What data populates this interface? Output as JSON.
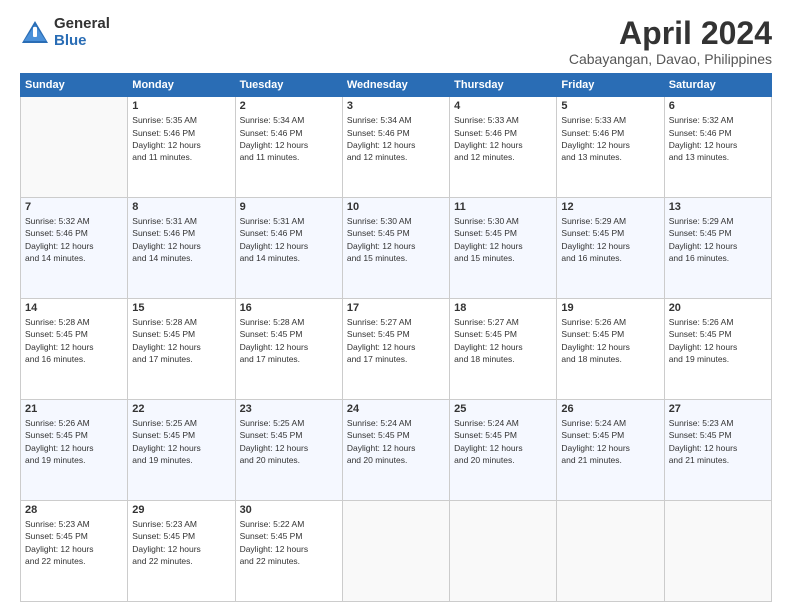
{
  "logo": {
    "general": "General",
    "blue": "Blue"
  },
  "title": "April 2024",
  "location": "Cabayangan, Davao, Philippines",
  "days_header": [
    "Sunday",
    "Monday",
    "Tuesday",
    "Wednesday",
    "Thursday",
    "Friday",
    "Saturday"
  ],
  "weeks": [
    [
      {
        "day": "",
        "info": ""
      },
      {
        "day": "1",
        "info": "Sunrise: 5:35 AM\nSunset: 5:46 PM\nDaylight: 12 hours\nand 11 minutes."
      },
      {
        "day": "2",
        "info": "Sunrise: 5:34 AM\nSunset: 5:46 PM\nDaylight: 12 hours\nand 11 minutes."
      },
      {
        "day": "3",
        "info": "Sunrise: 5:34 AM\nSunset: 5:46 PM\nDaylight: 12 hours\nand 12 minutes."
      },
      {
        "day": "4",
        "info": "Sunrise: 5:33 AM\nSunset: 5:46 PM\nDaylight: 12 hours\nand 12 minutes."
      },
      {
        "day": "5",
        "info": "Sunrise: 5:33 AM\nSunset: 5:46 PM\nDaylight: 12 hours\nand 13 minutes."
      },
      {
        "day": "6",
        "info": "Sunrise: 5:32 AM\nSunset: 5:46 PM\nDaylight: 12 hours\nand 13 minutes."
      }
    ],
    [
      {
        "day": "7",
        "info": "Sunrise: 5:32 AM\nSunset: 5:46 PM\nDaylight: 12 hours\nand 14 minutes."
      },
      {
        "day": "8",
        "info": "Sunrise: 5:31 AM\nSunset: 5:46 PM\nDaylight: 12 hours\nand 14 minutes."
      },
      {
        "day": "9",
        "info": "Sunrise: 5:31 AM\nSunset: 5:46 PM\nDaylight: 12 hours\nand 14 minutes."
      },
      {
        "day": "10",
        "info": "Sunrise: 5:30 AM\nSunset: 5:45 PM\nDaylight: 12 hours\nand 15 minutes."
      },
      {
        "day": "11",
        "info": "Sunrise: 5:30 AM\nSunset: 5:45 PM\nDaylight: 12 hours\nand 15 minutes."
      },
      {
        "day": "12",
        "info": "Sunrise: 5:29 AM\nSunset: 5:45 PM\nDaylight: 12 hours\nand 16 minutes."
      },
      {
        "day": "13",
        "info": "Sunrise: 5:29 AM\nSunset: 5:45 PM\nDaylight: 12 hours\nand 16 minutes."
      }
    ],
    [
      {
        "day": "14",
        "info": "Sunrise: 5:28 AM\nSunset: 5:45 PM\nDaylight: 12 hours\nand 16 minutes."
      },
      {
        "day": "15",
        "info": "Sunrise: 5:28 AM\nSunset: 5:45 PM\nDaylight: 12 hours\nand 17 minutes."
      },
      {
        "day": "16",
        "info": "Sunrise: 5:28 AM\nSunset: 5:45 PM\nDaylight: 12 hours\nand 17 minutes."
      },
      {
        "day": "17",
        "info": "Sunrise: 5:27 AM\nSunset: 5:45 PM\nDaylight: 12 hours\nand 17 minutes."
      },
      {
        "day": "18",
        "info": "Sunrise: 5:27 AM\nSunset: 5:45 PM\nDaylight: 12 hours\nand 18 minutes."
      },
      {
        "day": "19",
        "info": "Sunrise: 5:26 AM\nSunset: 5:45 PM\nDaylight: 12 hours\nand 18 minutes."
      },
      {
        "day": "20",
        "info": "Sunrise: 5:26 AM\nSunset: 5:45 PM\nDaylight: 12 hours\nand 19 minutes."
      }
    ],
    [
      {
        "day": "21",
        "info": "Sunrise: 5:26 AM\nSunset: 5:45 PM\nDaylight: 12 hours\nand 19 minutes."
      },
      {
        "day": "22",
        "info": "Sunrise: 5:25 AM\nSunset: 5:45 PM\nDaylight: 12 hours\nand 19 minutes."
      },
      {
        "day": "23",
        "info": "Sunrise: 5:25 AM\nSunset: 5:45 PM\nDaylight: 12 hours\nand 20 minutes."
      },
      {
        "day": "24",
        "info": "Sunrise: 5:24 AM\nSunset: 5:45 PM\nDaylight: 12 hours\nand 20 minutes."
      },
      {
        "day": "25",
        "info": "Sunrise: 5:24 AM\nSunset: 5:45 PM\nDaylight: 12 hours\nand 20 minutes."
      },
      {
        "day": "26",
        "info": "Sunrise: 5:24 AM\nSunset: 5:45 PM\nDaylight: 12 hours\nand 21 minutes."
      },
      {
        "day": "27",
        "info": "Sunrise: 5:23 AM\nSunset: 5:45 PM\nDaylight: 12 hours\nand 21 minutes."
      }
    ],
    [
      {
        "day": "28",
        "info": "Sunrise: 5:23 AM\nSunset: 5:45 PM\nDaylight: 12 hours\nand 22 minutes."
      },
      {
        "day": "29",
        "info": "Sunrise: 5:23 AM\nSunset: 5:45 PM\nDaylight: 12 hours\nand 22 minutes."
      },
      {
        "day": "30",
        "info": "Sunrise: 5:22 AM\nSunset: 5:45 PM\nDaylight: 12 hours\nand 22 minutes."
      },
      {
        "day": "",
        "info": ""
      },
      {
        "day": "",
        "info": ""
      },
      {
        "day": "",
        "info": ""
      },
      {
        "day": "",
        "info": ""
      }
    ]
  ]
}
